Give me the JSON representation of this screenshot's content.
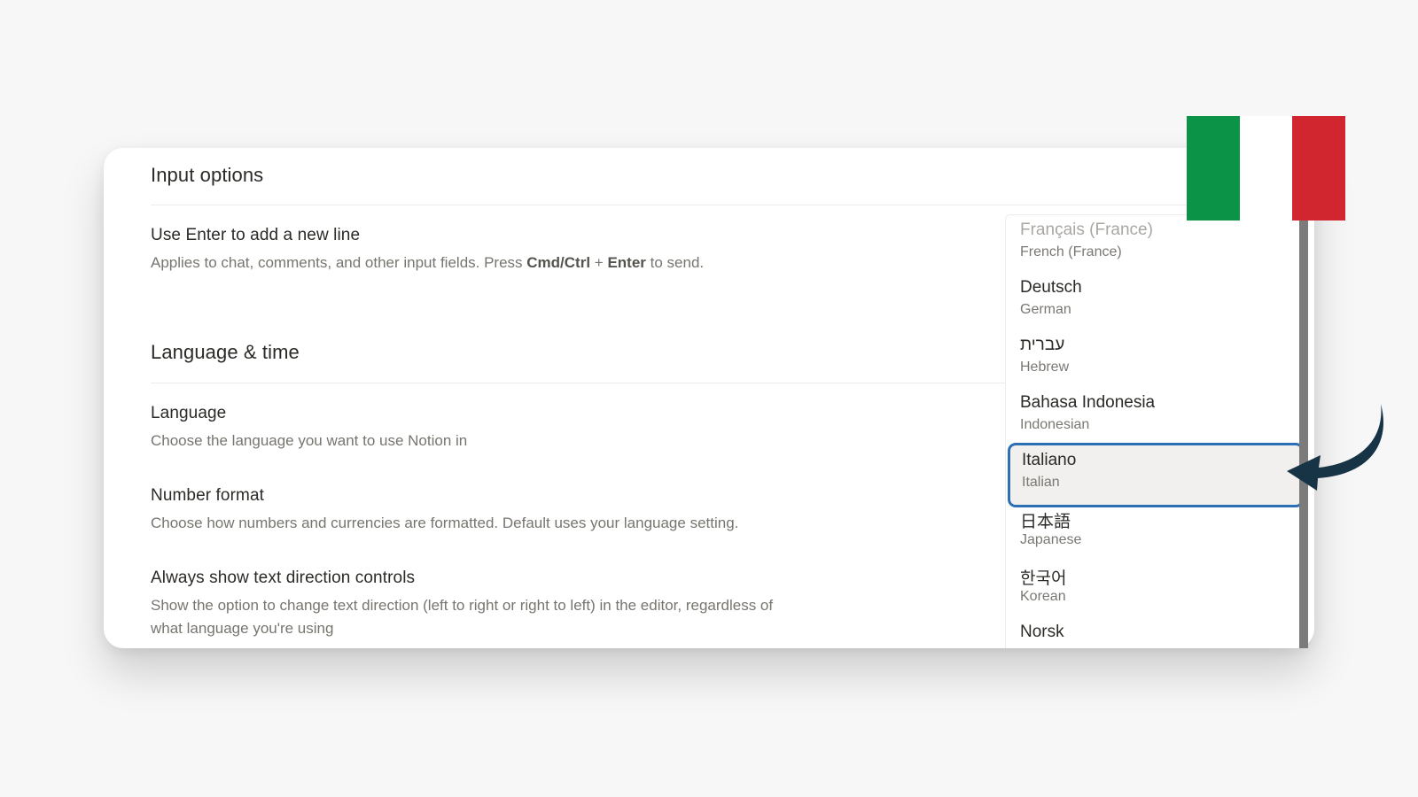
{
  "input_options": {
    "title": "Input options",
    "enter_setting": {
      "title": "Use Enter to add a new line",
      "desc_before": "Applies to chat, comments, and other input fields. Press ",
      "key1": "Cmd/Ctrl",
      "plus": " + ",
      "key2": "Enter",
      "desc_after": " to send."
    }
  },
  "language_time": {
    "title": "Language & time",
    "language": {
      "title": "Language",
      "desc": "Choose the language you want to use Notion in"
    },
    "number_format": {
      "title": "Number format",
      "desc": "Choose how numbers and currencies are formatted. Default uses your language setting."
    },
    "text_direction": {
      "title": "Always show text direction controls",
      "desc_line1": "Show the option to change text direction (left to right or right to left) in the editor, regardless of",
      "desc_line2": "what language you're using"
    }
  },
  "language_dropdown": {
    "items": [
      {
        "native": "Français (France)",
        "english": "French (France)"
      },
      {
        "native": "Deutsch",
        "english": "German"
      },
      {
        "native": "עברית",
        "english": "Hebrew"
      },
      {
        "native": "Bahasa Indonesia",
        "english": "Indonesian"
      },
      {
        "native": "Italiano",
        "english": "Italian"
      },
      {
        "native": "日本語",
        "english": "Japanese"
      },
      {
        "native": "한국어",
        "english": "Korean"
      },
      {
        "native": "Norsk",
        "english": ""
      }
    ],
    "selected_index": 4
  },
  "decorations": {
    "flag_icon": "italy-flag-icon",
    "flag_colors": [
      "#0b9347",
      "#ffffff",
      "#d1262f"
    ],
    "arrow_icon": "curved-arrow-icon",
    "arrow_color": "#173447",
    "selection_border_color": "#2c6fb5"
  }
}
